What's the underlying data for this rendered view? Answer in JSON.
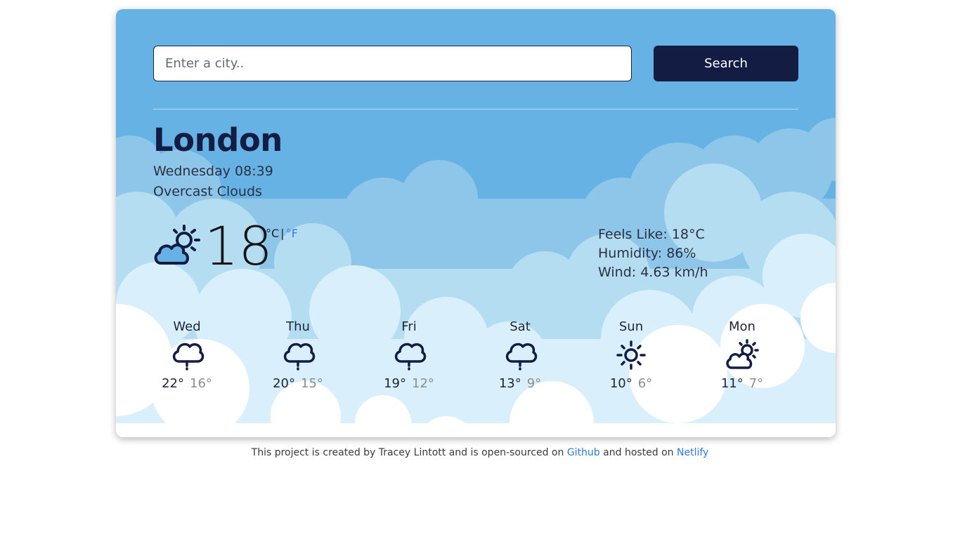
{
  "search": {
    "placeholder": "Enter a city..",
    "button_label": "Search"
  },
  "weather": {
    "city": "London",
    "date": "Wednesday 08:39",
    "description": "Overcast Clouds",
    "icon": "partly-cloudy-icon",
    "temperature": "18",
    "unit_c": "°C",
    "unit_sep": "|",
    "unit_f": "°F",
    "feels_like": "Feels Like: 18°C",
    "humidity": "Humidity: 86%",
    "wind": "Wind: 4.63 km/h"
  },
  "forecast": [
    {
      "day": "Wed",
      "max": "22°",
      "min": "16°",
      "icon": "rain-cloud-icon"
    },
    {
      "day": "Thu",
      "max": "20°",
      "min": "15°",
      "icon": "rain-cloud-icon"
    },
    {
      "day": "Fri",
      "max": "19°",
      "min": "12°",
      "icon": "rain-cloud-icon"
    },
    {
      "day": "Sat",
      "max": "13°",
      "min": "9°",
      "icon": "rain-cloud-icon"
    },
    {
      "day": "Sun",
      "max": "10°",
      "min": "6°",
      "icon": "sun-icon"
    },
    {
      "day": "Mon",
      "max": "11°",
      "min": "7°",
      "icon": "partly-cloudy-icon"
    }
  ],
  "footer": {
    "text_before": "This project is created by Tracey Lintott and is open-sourced on ",
    "github_label": "Github",
    "text_middle": " and hosted on ",
    "netlify_label": "Netlify"
  },
  "colors": {
    "sky": "#66b2e4",
    "primary_dark": "#131d43",
    "link_blue": "#2f78e0"
  }
}
